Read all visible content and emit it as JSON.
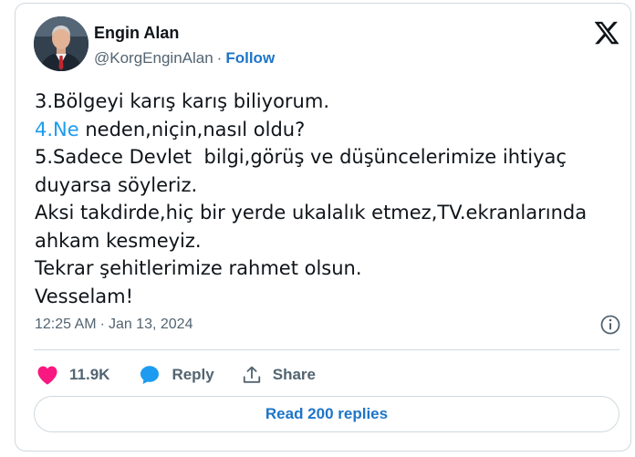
{
  "author": {
    "name": "Engin Alan",
    "handle": "@KorgEnginAlan",
    "separator": "·",
    "follow_label": "Follow",
    "avatar_icon": "profile-photo"
  },
  "brand": {
    "logo_icon": "x-logo"
  },
  "tweet": {
    "lines": [
      "3.Bölgeyi karış karış biliyorum.",
      "neden,niçin,nasıl oldu?",
      "5.Sadece Devlet  bilgi,görüş ve düşüncelerimize ihtiyaç",
      "duyarsa söyleriz.",
      "Aksi takdirde,hiç bir yerde ukalalık etmez,TV.ekranlarında",
      "ahkam kesmeyiz.",
      "Tekrar şehitlerimize rahmet olsun.",
      "Vesselam!"
    ],
    "hashtag": "4.Ne",
    "hashtag_color": "#1d9bf0"
  },
  "meta": {
    "time": "12:25 AM",
    "separator": "·",
    "date": "Jan 13, 2024",
    "info_icon": "info-icon"
  },
  "actions": {
    "like_count": "11.9K",
    "like_color": "#f91880",
    "reply_label": "Reply",
    "reply_color": "#1d9bf0",
    "share_label": "Share"
  },
  "read_replies_label": "Read 200 replies",
  "colors": {
    "link": "#1d75c8",
    "secondary_text": "#536471",
    "border": "#cfd9de"
  }
}
